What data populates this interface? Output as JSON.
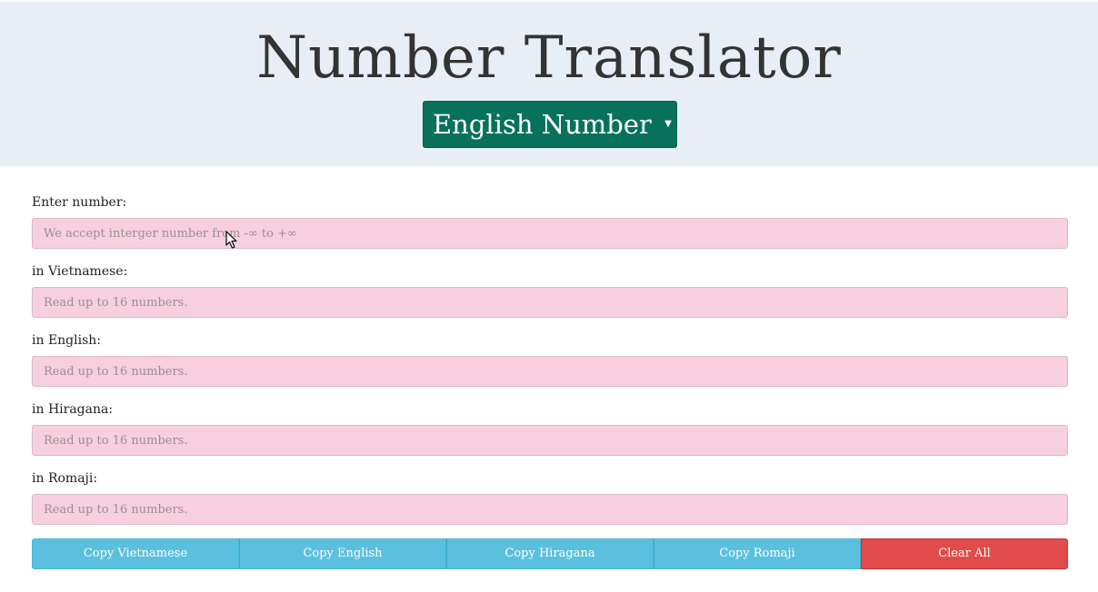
{
  "header": {
    "title": "Number Translator",
    "mode_select": {
      "selected": "English Number"
    }
  },
  "form": {
    "input": {
      "label": "Enter number:",
      "placeholder": "We accept interger number from -∞ to +∞",
      "value": ""
    },
    "vietnamese": {
      "label": "in Vietnamese:",
      "placeholder": "Read up to 16 numbers.",
      "value": ""
    },
    "english": {
      "label": "in English:",
      "placeholder": "Read up to 16 numbers.",
      "value": ""
    },
    "hiragana": {
      "label": "in Hiragana:",
      "placeholder": "Read up to 16 numbers.",
      "value": ""
    },
    "romaji": {
      "label": "in Romaji:",
      "placeholder": "Read up to 16 numbers.",
      "value": ""
    }
  },
  "buttons": {
    "copy_vietnamese": "Copy Vietnamese",
    "copy_english": "Copy English",
    "copy_hiragana": "Copy Hiragana",
    "copy_romaji": "Copy Romaji",
    "clear_all": "Clear All"
  },
  "colors": {
    "header_bg": "#e7eef6",
    "select_bg": "#07715b",
    "field_bg": "#f7cfdf",
    "info_button": "#5bc0de",
    "danger_button": "#e24b4b"
  },
  "icons": {
    "select_caret": "caret-down-icon",
    "cursor": "mouse-pointer-icon"
  }
}
